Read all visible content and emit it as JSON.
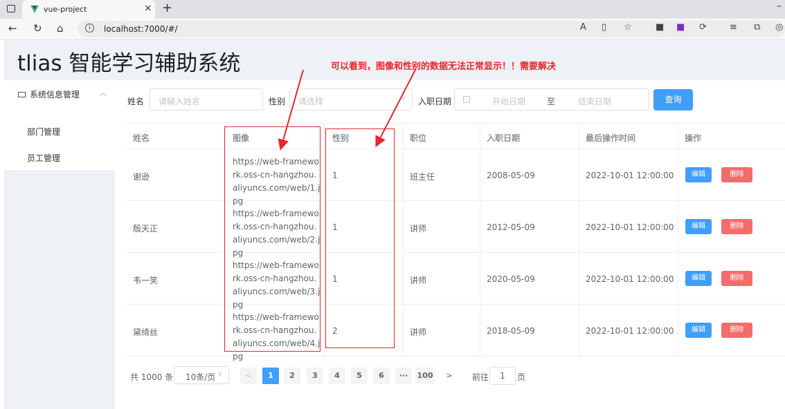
{
  "browser": {
    "tab_title": "vue-project",
    "tab_close": "×",
    "new_tab": "+",
    "url": "localhost:7000/#/",
    "window_min": "–",
    "icons": [
      "tab-actions-icon",
      "back-icon",
      "refresh-icon",
      "home-icon",
      "info-icon",
      "read-aloud-icon",
      "split-screen-icon",
      "favorite-icon",
      "extensions-icon",
      "app-icon",
      "sync-icon",
      "favorites-bar-icon",
      "collections-icon",
      "copilot-icon"
    ]
  },
  "app": {
    "title": "tlias 智能学习辅助系统",
    "annotation": "可以看到，图像和性别的数据无法正常显示！！需要解决"
  },
  "sidebar": {
    "group_label": "系统信息管理",
    "items": [
      {
        "label": "部门管理"
      },
      {
        "label": "员工管理"
      }
    ]
  },
  "filter": {
    "name_label": "姓名",
    "name_placeholder": "请输入姓名",
    "gender_label": "性别",
    "gender_placeholder": "请选择",
    "date_label": "入职日期",
    "date_start_placeholder": "开始日期",
    "date_sep": "至",
    "date_end_placeholder": "结束日期",
    "query_button": "查询"
  },
  "table": {
    "headers": [
      "姓名",
      "图像",
      "性别",
      "职位",
      "入职日期",
      "最后操作时间",
      "操作"
    ],
    "rows": [
      {
        "name": "谢逊",
        "image": "https://web-framework.oss-cn-hangzhou.aliyuncs.com/web/1.jpg",
        "gender": "1",
        "job": "班主任",
        "entry_date": "2008-05-09",
        "update_time": "2022-10-01 12:00:00"
      },
      {
        "name": "殷天正",
        "image": "https://web-framework.oss-cn-hangzhou.aliyuncs.com/web/2.jpg",
        "gender": "1",
        "job": "讲师",
        "entry_date": "2012-05-09",
        "update_time": "2022-10-01 12:00:00"
      },
      {
        "name": "韦一笑",
        "image": "https://web-framework.oss-cn-hangzhou.aliyuncs.com/web/3.jpg",
        "gender": "1",
        "job": "讲师",
        "entry_date": "2020-05-09",
        "update_time": "2022-10-01 12:00:00"
      },
      {
        "name": "黛绮丝",
        "image": "https://web-framework.oss-cn-hangzhou.aliyuncs.com/web/4.jpg",
        "gender": "2",
        "job": "讲师",
        "entry_date": "2018-05-09",
        "update_time": "2022-10-01 12:00:00"
      }
    ],
    "edit_label": "编辑",
    "delete_label": "删除"
  },
  "pagination": {
    "total": "共 1000 条",
    "page_size": "10条/页",
    "prev": "<",
    "pages": [
      "1",
      "2",
      "3",
      "4",
      "5",
      "6",
      "···",
      "100"
    ],
    "active_page": "1",
    "next": ">",
    "goto_label": "前往",
    "goto_value": "1",
    "page_suffix": "页"
  },
  "colors": {
    "primary": "#409eff",
    "danger": "#f56c6c",
    "annotation": "#e8262c",
    "header_bg": "#eef1f6"
  }
}
